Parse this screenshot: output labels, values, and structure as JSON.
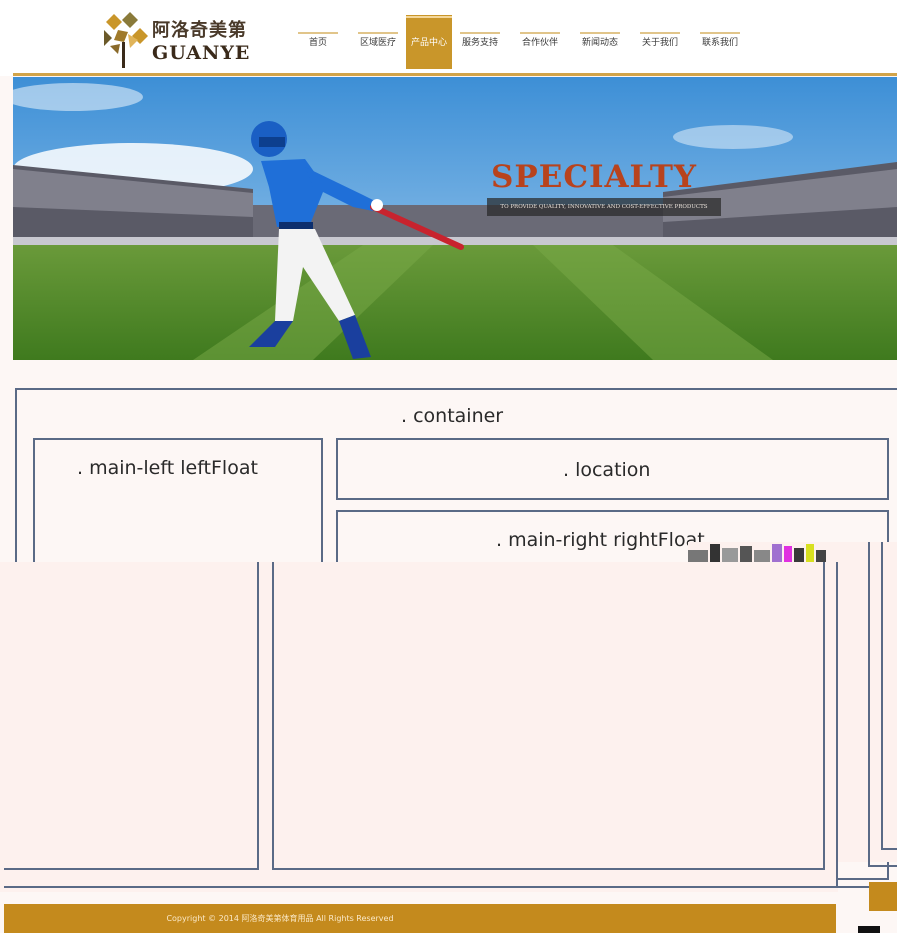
{
  "header": {
    "logo_cn": "阿洛奇美第",
    "logo_en": "GUANYE",
    "nav": [
      {
        "label": "首页",
        "active": false
      },
      {
        "label": "区域医疗",
        "active": false
      },
      {
        "label": "产品中心",
        "active": true
      },
      {
        "label": "服务支持",
        "active": false
      },
      {
        "label": "合作伙伴",
        "active": false
      },
      {
        "label": "新闻动态",
        "active": false
      },
      {
        "label": "关于我们",
        "active": false
      },
      {
        "label": "联系我们",
        "active": false
      }
    ],
    "accent": "#c9962a"
  },
  "banner": {
    "title": "SPECIALTY",
    "subtitle": "TO PROVIDE QUALITY, INNOVATIVE AND COST-EFFECTIVE PRODUCTS"
  },
  "wireframe": {
    "container": ". container",
    "main_left": ". main-left leftFloat",
    "location": ". location",
    "main_right": ". main-right rightFloat",
    "border_color": "#5a6a86"
  },
  "footer": {
    "copyright": "Copyright © 2014 阿洛奇美第体育用品 All Rights Reserved",
    "color": "#c48a1d"
  }
}
